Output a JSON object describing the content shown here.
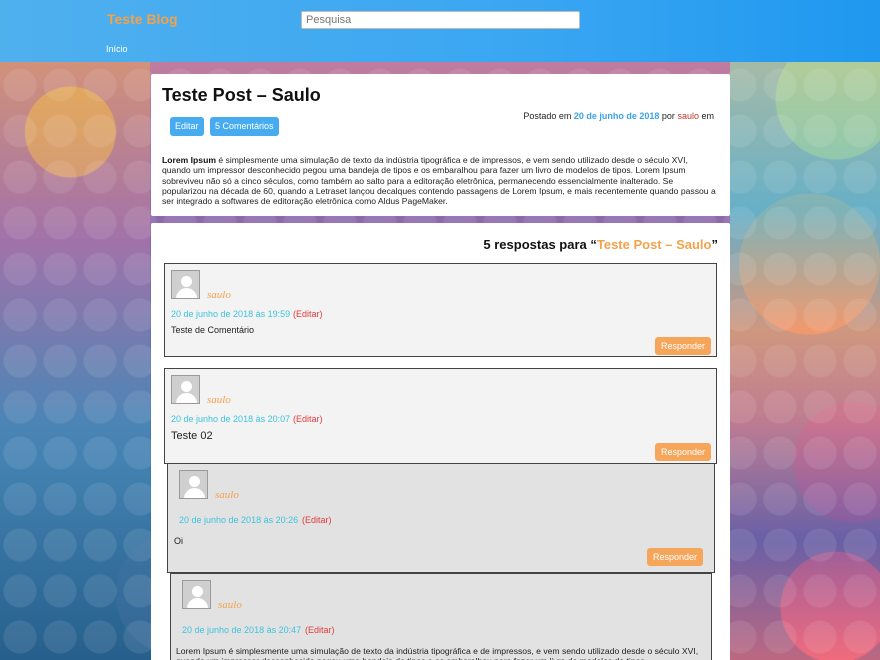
{
  "header": {
    "brand": "Teste Blog",
    "search_placeholder": "Pesquisa",
    "nav_home": "Início"
  },
  "post": {
    "title": "Teste Post – Saulo",
    "edit_label": "Editar",
    "comments_label": "5 Comentários",
    "meta_prefix": "Postado em",
    "date": "20 de junho de 2018",
    "by": "por",
    "author": "saulo",
    "in": "em",
    "body_strong": "Lorem Ipsum",
    "body_text": " é simplesmente uma simulação de texto da indústria tipográfica e de impressos, e vem sendo utilizado desde o século XVI, quando um impressor desconhecido pegou uma bandeja de tipos e os embaralhou para fazer um livro de modelos de tipos. Lorem Ipsum sobreviveu não só a cinco séculos, como também ao salto para a editoração eletrônica, permanecendo essencialmente inalterado. Se popularizou na década de 60, quando a Letraset lançou decalques contendo passagens de Lorem Ipsum, e mais recentemente quando passou a ser integrado a softwares de editoração eletrônica como Aldus PageMaker."
  },
  "comments": {
    "heading_prefix": "5 respostas para “",
    "heading_post": "Teste Post – Saulo",
    "heading_suffix": "”",
    "items": [
      {
        "author": "saulo",
        "date": "20 de junho de 2018 às 19:59",
        "edit": "(Editar)",
        "text": "Teste de Comentário",
        "reply": "Responder"
      },
      {
        "author": "saulo",
        "date": "20 de junho de 2018 às 20:07",
        "edit": "(Editar)",
        "text": "Teste 02",
        "reply": "Responder"
      },
      {
        "author": "saulo",
        "date": "20 de junho de 2018 às 20:26",
        "edit": "(Editar)",
        "text": "Oi",
        "reply": "Responder"
      },
      {
        "author": "saulo",
        "date": "20 de junho de 2018 às 20:47",
        "edit": "(Editar)",
        "text": "Lorem Ipsum é simplesmente uma simulação de texto da indústria tipográfica e de impressos, e vem sendo utilizado desde o século XVI, quando um impressor desconhecido pegou uma bandeja de tipos e os embaralhou para fazer um livro de modelos de tipos."
      }
    ]
  },
  "colors": {
    "accent_orange": "#f3a24c",
    "accent_blue": "#47abef",
    "date_cyan": "#3cc3dd",
    "edit_red": "#e23a3a"
  }
}
